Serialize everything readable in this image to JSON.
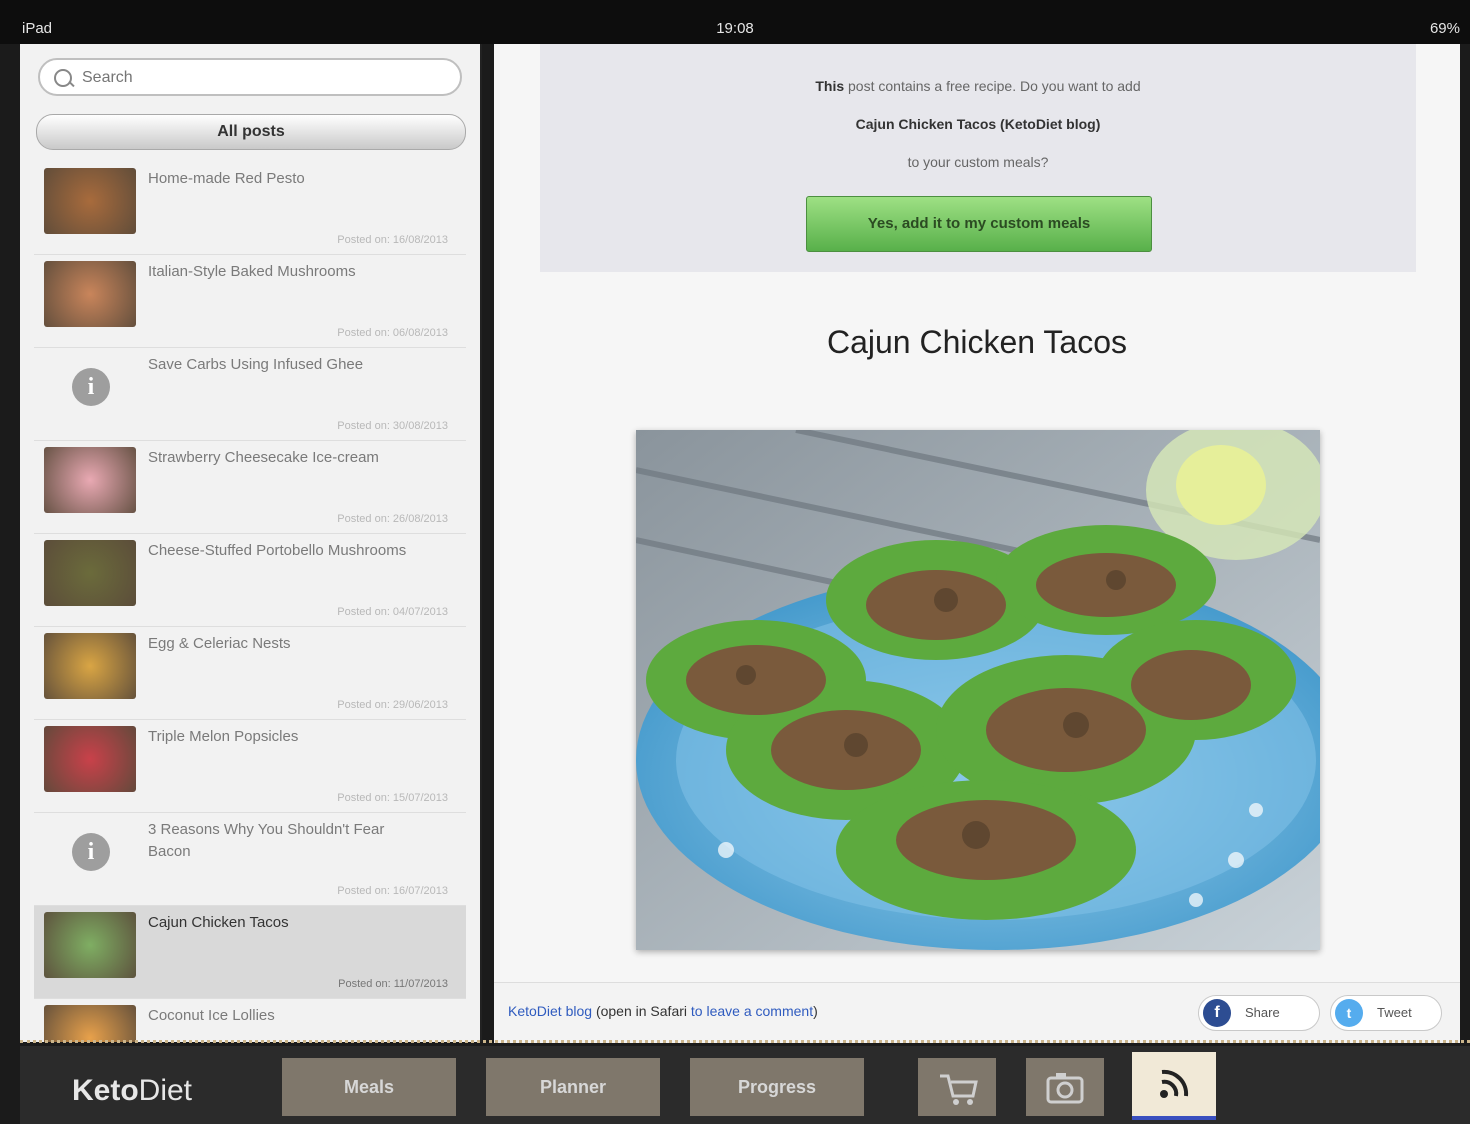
{
  "status_bar": {
    "device": "iPad",
    "time": "19:08",
    "battery": "69%"
  },
  "sidebar": {
    "search_placeholder": "Search",
    "filter_label": "All posts",
    "items": [
      {
        "title": "Home-made Red Pesto",
        "posted": "Posted on: 16/08/2013",
        "thumb_color": "#a86b3c",
        "info_icon": false,
        "selected": false
      },
      {
        "title": "Italian-Style Baked Mushrooms",
        "posted": "Posted on: 06/08/2013",
        "thumb_color": "#c9855b",
        "info_icon": false,
        "selected": false
      },
      {
        "title": "Save Carbs Using Infused Ghee",
        "posted": "Posted on: 30/08/2013",
        "thumb_color": "#9e9e9e",
        "info_icon": true,
        "selected": false
      },
      {
        "title": "Strawberry Cheesecake Ice-cream",
        "posted": "Posted on: 26/08/2013",
        "thumb_color": "#e9a9b3",
        "info_icon": false,
        "selected": false
      },
      {
        "title": "Cheese-Stuffed Portobello Mushrooms",
        "posted": "Posted on: 04/07/2013",
        "thumb_color": "#6b6b3b",
        "info_icon": false,
        "selected": false
      },
      {
        "title": "Egg & Celeriac Nests",
        "posted": "Posted on: 29/06/2013",
        "thumb_color": "#d9a544",
        "info_icon": false,
        "selected": false
      },
      {
        "title": "Triple Melon Popsicles",
        "posted": "Posted on: 15/07/2013",
        "thumb_color": "#c9414a",
        "info_icon": false,
        "selected": false
      },
      {
        "title": "3 Reasons Why You Shouldn't Fear Bacon",
        "posted": "Posted on: 16/07/2013",
        "thumb_color": "#9e9e9e",
        "info_icon": true,
        "selected": false
      },
      {
        "title": "Cajun Chicken Tacos",
        "posted": "Posted on: 11/07/2013",
        "thumb_color": "#7fae63",
        "info_icon": false,
        "selected": true
      },
      {
        "title": "Coconut Ice Lollies",
        "posted": "",
        "thumb_color": "#e8a14b",
        "info_icon": false,
        "selected": false
      }
    ]
  },
  "content": {
    "banner": {
      "line1_bold": "This",
      "line1": " post contains a free recipe. Do you want to add",
      "line2": "Cajun Chicken Tacos (KetoDiet blog)",
      "line3": "to your custom meals?",
      "add_button": "Yes, add it to my custom meals"
    },
    "post_title": "Cajun Chicken Tacos",
    "footer": {
      "blog_link": "KetoDiet blog",
      "open_text": " (open in Safari ",
      "comment_link": "to leave a comment",
      "close_paren": ")",
      "share_label": "Share",
      "tweet_label": "Tweet"
    }
  },
  "tabbar": {
    "brand_bold": "Keto",
    "brand_rest": "Diet",
    "tabs": [
      "Meals",
      "Planner",
      "Progress"
    ],
    "icons": [
      "shopping-cart-icon",
      "camera-icon",
      "rss-feed-icon"
    ]
  }
}
